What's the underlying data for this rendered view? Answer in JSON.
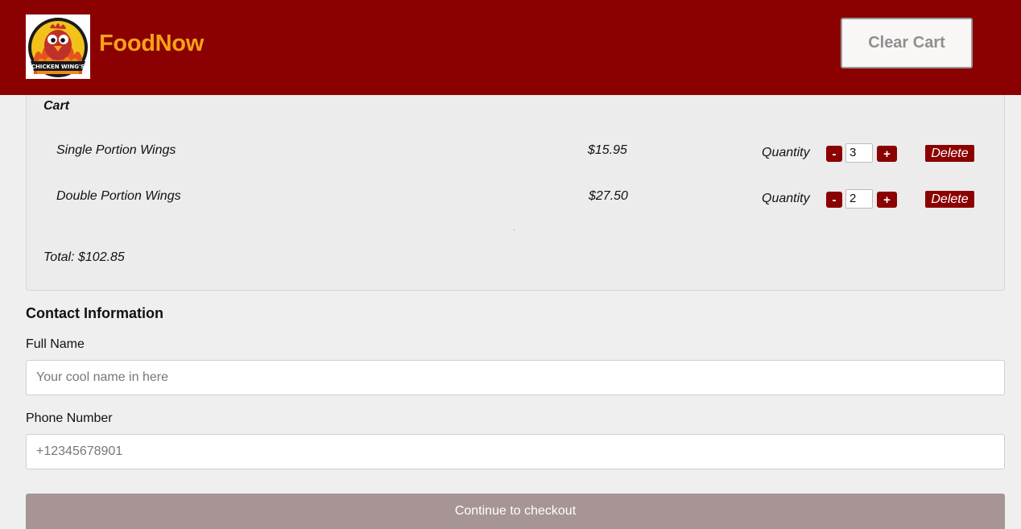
{
  "header": {
    "brand": "FoodNow",
    "logo_text": "CHICKEN WING'S",
    "clear_cart_label": "Clear Cart",
    "brand_color": "#f7a11a",
    "bar_color": "#8b0000"
  },
  "cart": {
    "title": "Cart",
    "quantity_label": "Quantity",
    "minus_label": "-",
    "plus_label": "+",
    "delete_label": "Delete",
    "items": [
      {
        "name": "Single Portion Wings",
        "price": "$15.95",
        "quantity": "3"
      },
      {
        "name": "Double Portion Wings",
        "price": "$27.50",
        "quantity": "2"
      }
    ],
    "total": "Total: $102.85"
  },
  "contact": {
    "title": "Contact Information",
    "full_name_label": "Full Name",
    "full_name_placeholder": "Your cool name in here",
    "phone_label": "Phone Number",
    "phone_placeholder": "+12345678901"
  },
  "checkout_label": "Continue to checkout"
}
